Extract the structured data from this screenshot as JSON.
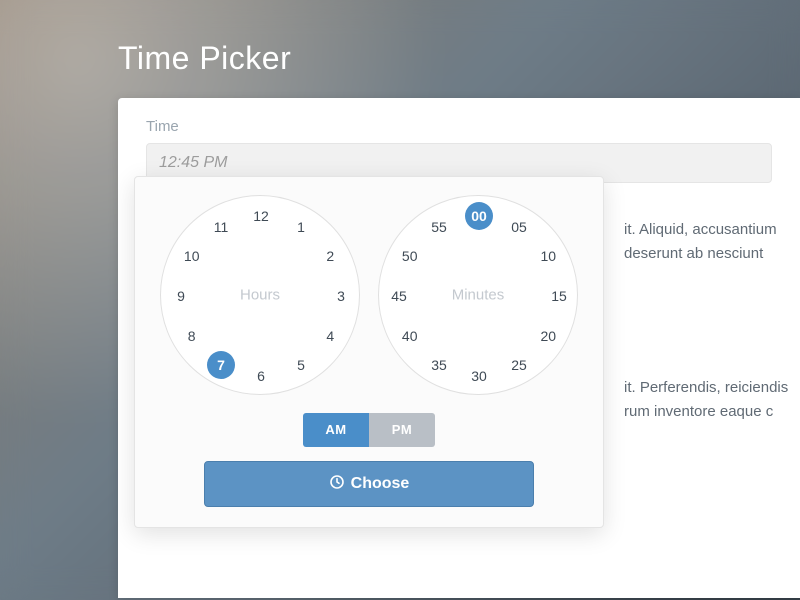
{
  "title": "Time Picker",
  "field": {
    "label": "Time",
    "value": "12:45 PM"
  },
  "hours": {
    "label": "Hours",
    "ticks": [
      "12",
      "1",
      "2",
      "3",
      "4",
      "5",
      "6",
      "7",
      "8",
      "9",
      "10",
      "11"
    ],
    "selected": "7"
  },
  "minutes": {
    "label": "Minutes",
    "ticks": [
      "00",
      "05",
      "10",
      "15",
      "20",
      "25",
      "30",
      "35",
      "40",
      "45",
      "50",
      "55"
    ],
    "selected": "00"
  },
  "ampm": {
    "am": "AM",
    "pm": "PM",
    "selected": "AM"
  },
  "choose": "Choose",
  "bg": {
    "p1": "it. Aliquid, accusantium deserunt ab nesciunt",
    "p2": "it. Perferendis, reiciendis rum inventore eaque c"
  }
}
